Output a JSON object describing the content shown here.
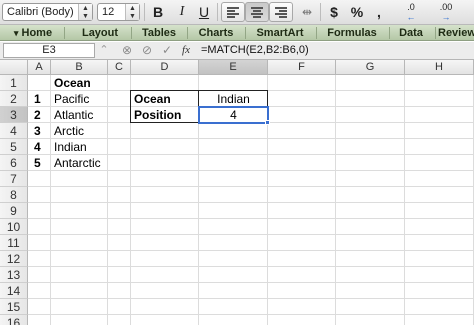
{
  "toolbar": {
    "font_name": "Calibri (Body)",
    "font_size": "12",
    "bold_label": "B",
    "italic_label": "I",
    "underline_label": "U",
    "currency_label": "$",
    "percent_label": "%",
    "comma_label": ",",
    "inc_decimal_label": ".0",
    "dec_decimal_label": ".00"
  },
  "ribbon": {
    "tabs": [
      {
        "label": "Home"
      },
      {
        "label": "Layout"
      },
      {
        "label": "Tables"
      },
      {
        "label": "Charts"
      },
      {
        "label": "SmartArt"
      },
      {
        "label": "Formulas"
      },
      {
        "label": "Data"
      },
      {
        "label": "Review"
      }
    ]
  },
  "formula_bar": {
    "name_box": "E3",
    "fx_label": "fx",
    "formula": "=MATCH(E2,B2:B6,0)"
  },
  "sheet": {
    "columns": [
      "A",
      "B",
      "C",
      "D",
      "E",
      "F",
      "G",
      "H"
    ],
    "rows": [
      "1",
      "2",
      "3",
      "4",
      "5",
      "6",
      "7",
      "8",
      "9",
      "10",
      "11",
      "12",
      "13",
      "14",
      "15",
      "16"
    ],
    "active_cell": "E3",
    "cells": {
      "B1": "Ocean",
      "A2": "1",
      "B2": "Pacific",
      "A3": "2",
      "B3": "Atlantic",
      "A4": "3",
      "B4": "Arctic",
      "A5": "4",
      "B5": "Indian",
      "A6": "5",
      "B6": "Antarctic",
      "D2": "Ocean",
      "E2": "Indian",
      "D3": "Position",
      "E3": "4"
    }
  },
  "colors": {
    "ribbon": "#c3d4b7",
    "selection": "#3a6fd0"
  }
}
